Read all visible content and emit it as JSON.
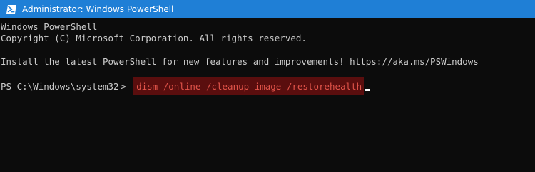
{
  "window": {
    "title": "Administrator: Windows PowerShell",
    "icon": "powershell-icon",
    "titlebar_color": "#1f7fd6",
    "background_color": "#0c0c0c"
  },
  "console": {
    "lines": [
      "Windows PowerShell",
      "Copyright (C) Microsoft Corporation. All rights reserved.",
      "Install the latest PowerShell for new features and improvements! https://aka.ms/PSWindows"
    ],
    "prompt": "PS C:\\Windows\\system32",
    "prompt_chevron": ">",
    "command": "dism /online /cleanup-image /restorehealth",
    "command_highlight_color": "#5a0e0e",
    "command_text_color": "#e2544a"
  }
}
